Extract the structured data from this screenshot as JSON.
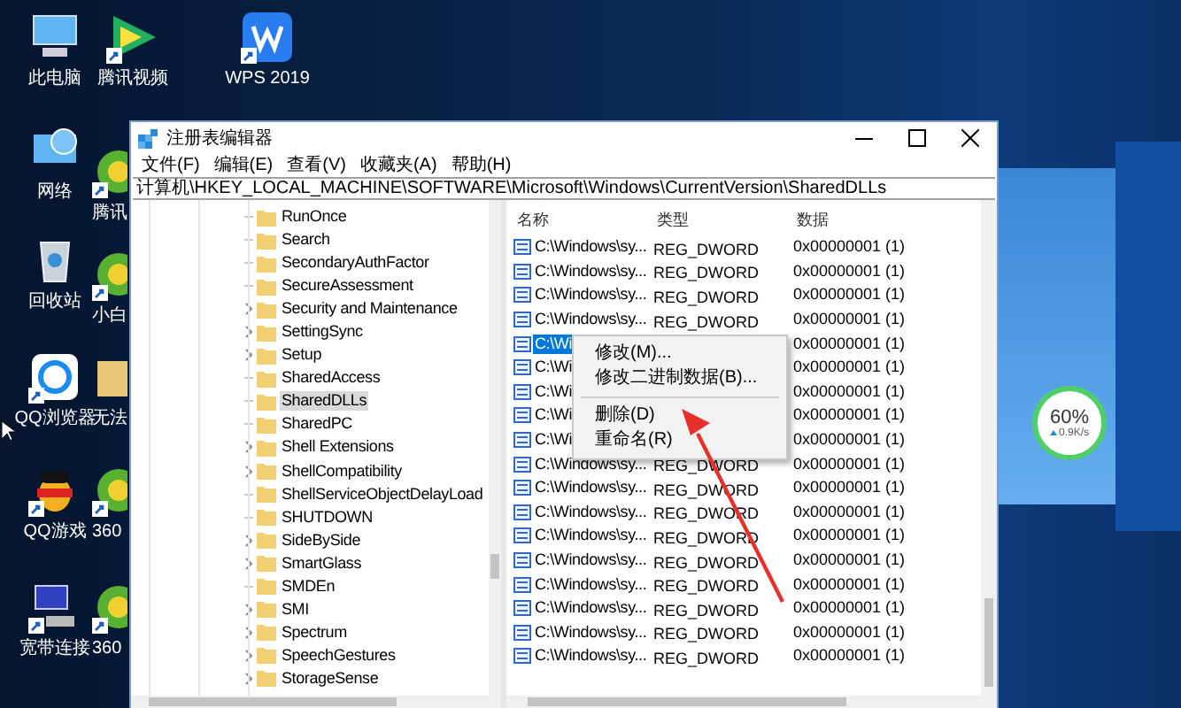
{
  "desktop_icons": [
    {
      "label": "此电脑",
      "kind": "computer",
      "shortcut": false
    },
    {
      "label": "网络",
      "kind": "network",
      "shortcut": false
    },
    {
      "label": "回收站",
      "kind": "recycle",
      "shortcut": false
    },
    {
      "label": "QQ浏览器",
      "kind": "browser",
      "shortcut": true
    },
    {
      "label": "QQ游戏",
      "kind": "game",
      "shortcut": true
    },
    {
      "label": "宽带连接",
      "kind": "broadband",
      "shortcut": true
    },
    {
      "label": "腾讯视频",
      "kind": "video",
      "shortcut": true
    },
    {
      "label": "腾讯",
      "kind": "app",
      "shortcut": true
    },
    {
      "label": "小白",
      "kind": "app",
      "shortcut": true
    },
    {
      "label": "无法",
      "kind": "folder",
      "shortcut": false
    },
    {
      "label": "360",
      "kind": "app",
      "shortcut": true
    },
    {
      "label": "360",
      "kind": "app",
      "shortcut": true
    },
    {
      "label": "WPS 2019",
      "kind": "wps",
      "shortcut": true
    }
  ],
  "window": {
    "title": "注册表编辑器",
    "menu": [
      "文件(F)",
      "编辑(E)",
      "查看(V)",
      "收藏夹(A)",
      "帮助(H)"
    ],
    "address": "计算机\\HKEY_LOCAL_MACHINE\\SOFTWARE\\Microsoft\\Windows\\CurrentVersion\\SharedDLLs",
    "tree": [
      {
        "label": "RunOnce",
        "has_children": false,
        "selected": false
      },
      {
        "label": "Search",
        "has_children": false,
        "selected": false
      },
      {
        "label": "SecondaryAuthFactor",
        "has_children": false,
        "selected": false
      },
      {
        "label": "SecureAssessment",
        "has_children": false,
        "selected": false
      },
      {
        "label": "Security and Maintenance",
        "has_children": true,
        "selected": false
      },
      {
        "label": "SettingSync",
        "has_children": true,
        "selected": false
      },
      {
        "label": "Setup",
        "has_children": true,
        "selected": false
      },
      {
        "label": "SharedAccess",
        "has_children": false,
        "selected": false
      },
      {
        "label": "SharedDLLs",
        "has_children": false,
        "selected": true
      },
      {
        "label": "SharedPC",
        "has_children": false,
        "selected": false
      },
      {
        "label": "Shell Extensions",
        "has_children": true,
        "selected": false
      },
      {
        "label": "ShellCompatibility",
        "has_children": true,
        "selected": false
      },
      {
        "label": "ShellServiceObjectDelayLoad",
        "has_children": false,
        "selected": false
      },
      {
        "label": "SHUTDOWN",
        "has_children": false,
        "selected": false
      },
      {
        "label": "SideBySide",
        "has_children": true,
        "selected": false
      },
      {
        "label": "SmartGlass",
        "has_children": true,
        "selected": false
      },
      {
        "label": "SMDEn",
        "has_children": false,
        "selected": false
      },
      {
        "label": "SMI",
        "has_children": true,
        "selected": false
      },
      {
        "label": "Spectrum",
        "has_children": true,
        "selected": false
      },
      {
        "label": "SpeechGestures",
        "has_children": true,
        "selected": false
      },
      {
        "label": "StorageSense",
        "has_children": true,
        "selected": false
      }
    ],
    "columns": [
      "名称",
      "类型",
      "数据"
    ],
    "rows": [
      {
        "name": "C:\\Windows\\sy...",
        "type": "REG_DWORD",
        "data": "0x00000001 (1)",
        "selected": false
      },
      {
        "name": "C:\\Windows\\sy...",
        "type": "REG_DWORD",
        "data": "0x00000001 (1)",
        "selected": false
      },
      {
        "name": "C:\\Windows\\sy...",
        "type": "REG_DWORD",
        "data": "0x00000001 (1)",
        "selected": false
      },
      {
        "name": "C:\\Windows\\sy...",
        "type": "REG_DWORD",
        "data": "0x00000001 (1)",
        "selected": false
      },
      {
        "name": "C:\\Wi",
        "data": "0x00000001 (1)",
        "selected": true
      },
      {
        "name": "C:\\Wi",
        "data": "0x00000001 (1)",
        "selected": false
      },
      {
        "name": "C:\\Wi",
        "data": "0x00000001 (1)",
        "selected": false
      },
      {
        "name": "C:\\Wi",
        "data": "0x00000001 (1)",
        "selected": false
      },
      {
        "name": "C:\\Wi",
        "data": "0x00000001 (1)",
        "selected": false
      },
      {
        "name": "C:\\Windows\\sy...",
        "type": "REG_DWORD",
        "data": "0x00000001 (1)",
        "selected": false
      },
      {
        "name": "C:\\Windows\\sy...",
        "type": "REG_DWORD",
        "data": "0x00000001 (1)",
        "selected": false
      },
      {
        "name": "C:\\Windows\\sy...",
        "type": "REG_DWORD",
        "data": "0x00000001 (1)",
        "selected": false
      },
      {
        "name": "C:\\Windows\\sy...",
        "type": "REG_DWORD",
        "data": "0x00000001 (1)",
        "selected": false
      },
      {
        "name": "C:\\Windows\\sy...",
        "type": "REG_DWORD",
        "data": "0x00000001 (1)",
        "selected": false
      },
      {
        "name": "C:\\Windows\\sy...",
        "type": "REG_DWORD",
        "data": "0x00000001 (1)",
        "selected": false
      },
      {
        "name": "C:\\Windows\\sy...",
        "type": "REG_DWORD",
        "data": "0x00000001 (1)",
        "selected": false
      },
      {
        "name": "C:\\Windows\\sy...",
        "type": "REG_DWORD",
        "data": "0x00000001 (1)",
        "selected": false
      },
      {
        "name": "C:\\Windows\\sy...",
        "type": "REG_DWORD",
        "data": "0x00000001 (1)",
        "selected": false
      }
    ],
    "context_menu": [
      {
        "kind": "item",
        "label": "修改(M)..."
      },
      {
        "kind": "item",
        "label": "修改二进制数据(B)..."
      },
      {
        "kind": "separator"
      },
      {
        "kind": "item",
        "label": "删除(D)"
      },
      {
        "kind": "item",
        "label": "重命名(R)"
      }
    ]
  },
  "speed_ball": {
    "percent": "60%",
    "speed": "0.9K/s"
  }
}
